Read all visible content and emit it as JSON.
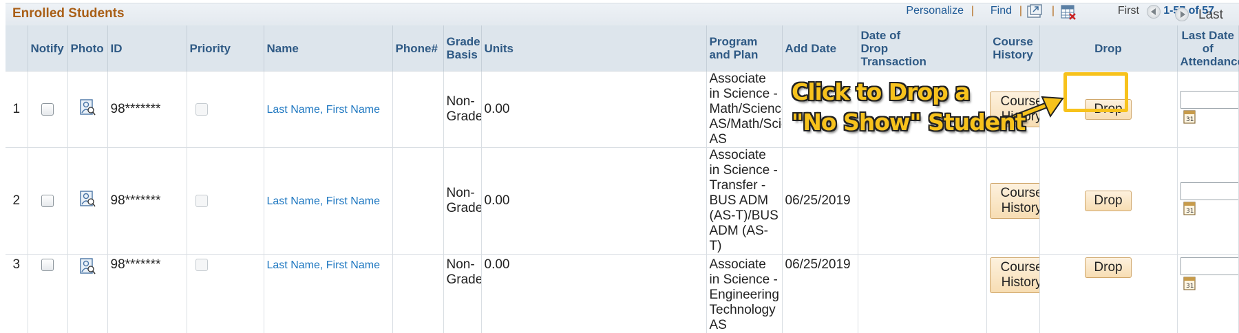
{
  "grid": {
    "title": "Enrolled Students",
    "toolbar": {
      "personalize": "Personalize",
      "sep1": "|",
      "find": "Find",
      "sep2": "|",
      "sep3": "|",
      "first": "First",
      "count": "1-57 of 57",
      "last": "Last"
    },
    "columns": {
      "notify": "Notify",
      "photo": "Photo",
      "id": "ID",
      "priority": "Priority",
      "name": "Name",
      "phone": "Phone#",
      "grade_basis_1": "Grade",
      "grade_basis_2": "Basis",
      "units": "Units",
      "program": "Program and Plan",
      "add_date": "Add Date",
      "drop_date_1": "Date of",
      "drop_date_2": "Drop",
      "drop_date_3": "Transaction",
      "course_history": "Course History",
      "drop": "Drop",
      "last_attend_1": "Last Date of",
      "last_attend_2": "Attendance"
    },
    "rows": [
      {
        "num": "1",
        "id": "98*******",
        "name": "Last Name, First Name",
        "grade_1": "Non-",
        "grade_2": "Graded",
        "units": "0.00",
        "program": "Associate in Science - Math/Science AS/Math/Science AS",
        "add_date": "",
        "course_history_btn": "Course History",
        "drop_btn": "Drop"
      },
      {
        "num": "2",
        "id": "98*******",
        "name": "Last Name, First Name",
        "grade_1": "Non-",
        "grade_2": "Graded",
        "units": "0.00",
        "program": "Associate in Science -Transfer - BUS ADM (AS-T)/BUS ADM (AS-T)",
        "add_date": "06/25/2019",
        "course_history_btn": "Course History",
        "drop_btn": "Drop"
      },
      {
        "num": "3",
        "id": "98*******",
        "name": "Last Name, First Name",
        "grade_1": "Non-",
        "grade_2": "Graded",
        "units": "0.00",
        "program": "Associate in Science - Engineering Technology AS",
        "add_date": "06/25/2019",
        "course_history_btn": "Course History",
        "drop_btn": "Drop"
      }
    ]
  },
  "annotation": {
    "line1": "Click to Drop a",
    "line2": "\"No Show\" Student",
    "color": "#f7c21c"
  },
  "colors": {
    "title": "#a95f17",
    "link": "#1f5a96",
    "header_bg": "#dde5ec",
    "button_bg": "#f7ddb3"
  }
}
